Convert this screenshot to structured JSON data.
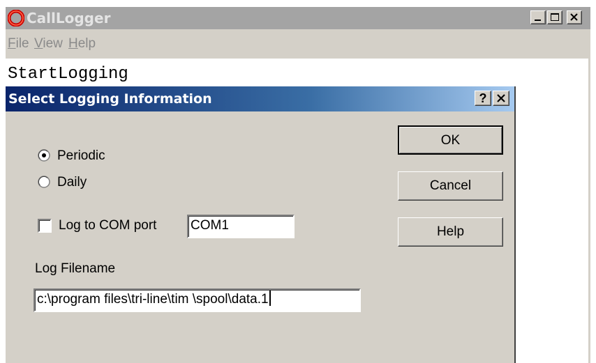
{
  "main_window": {
    "title": "CallLogger",
    "menu": [
      {
        "underline": "F",
        "rest": "ile"
      },
      {
        "underline": "V",
        "rest": "iew"
      },
      {
        "underline": "H",
        "rest": "elp"
      }
    ],
    "content_text": "StartLogging"
  },
  "dialog": {
    "title": "Select Logging Information",
    "help_glyph": "?",
    "options": {
      "periodic_label": "Periodic",
      "daily_label": "Daily",
      "selected": "Periodic"
    },
    "com_port": {
      "checkbox_label": "Log to COM port",
      "checked": false,
      "value": "COM1"
    },
    "filename": {
      "label": "Log Filename",
      "value": "c:\\program files\\tri-line\\tim \\spool\\data.1"
    },
    "buttons": {
      "ok": "OK",
      "cancel": "Cancel",
      "help": "Help"
    }
  },
  "colors": {
    "inactive_titlebar": "#a4a4a4",
    "active_titlebar_start": "#0a246a",
    "active_titlebar_end": "#a6caf0",
    "face": "#d4d0c8",
    "app_icon": "#cc0000"
  },
  "icons": [
    "app-icon",
    "minimize-icon",
    "maximize-icon",
    "close-icon",
    "help-icon"
  ]
}
